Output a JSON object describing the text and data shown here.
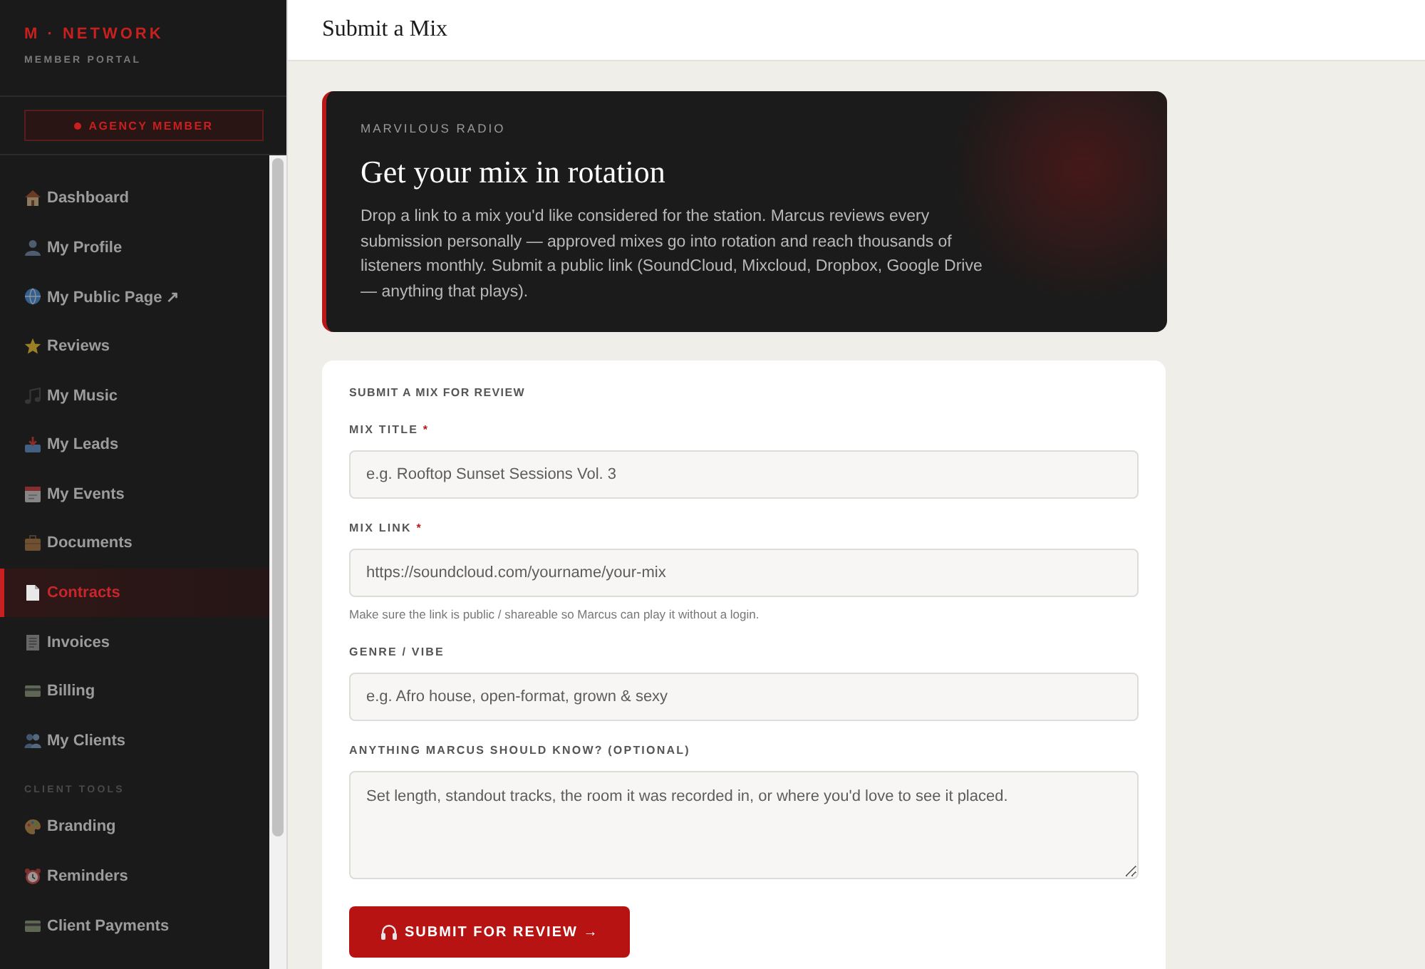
{
  "sidebar": {
    "brand": {
      "title": "M · NETWORK",
      "subtitle": "MEMBER PORTAL"
    },
    "badge": {
      "label": "AGENCY MEMBER"
    },
    "nav_groups": [
      {
        "items": [
          {
            "label": "Dashboard",
            "selected": false
          },
          {
            "label": "My Profile",
            "selected": false
          },
          {
            "label": "My Public Page ↗",
            "selected": false
          },
          {
            "label": "Reviews",
            "selected": false
          },
          {
            "label": "My Music",
            "selected": false
          },
          {
            "label": "My Leads",
            "selected": false
          },
          {
            "label": "My Events",
            "selected": false
          },
          {
            "label": "Documents",
            "selected": false
          },
          {
            "label": "Contracts",
            "selected": true
          },
          {
            "label": "Invoices",
            "selected": false
          },
          {
            "label": "Billing",
            "selected": false
          },
          {
            "label": "My Clients",
            "selected": false
          }
        ]
      },
      {
        "heading": "CLIENT TOOLS",
        "items": [
          {
            "label": "Branding",
            "selected": false
          },
          {
            "label": "Reminders",
            "selected": false
          },
          {
            "label": "Client Payments",
            "selected": false
          }
        ]
      }
    ]
  },
  "header": {
    "title": "Submit a Mix"
  },
  "hero": {
    "kicker": "MARVILOUS RADIO",
    "title": "Get your mix in rotation",
    "text": "Drop a link to a mix you'd like considered for the station. Marcus reviews every submission personally — approved mixes go into rotation and reach thousands of listeners monthly. Submit a public link (SoundCloud, Mixcloud, Dropbox, Google Drive — anything that plays)."
  },
  "form": {
    "title": "SUBMIT A MIX FOR REVIEW",
    "fields": [
      {
        "kind": "input",
        "label": "MIX TITLE",
        "required_mark": "*",
        "placeholder": "e.g. Rooftop Sunset Sessions Vol. 3"
      },
      {
        "kind": "input",
        "label": "MIX LINK",
        "required_mark": "*",
        "placeholder": "https://soundcloud.com/yourname/your-mix",
        "hint": "Make sure the link is public / shareable so Marcus can play it without a login."
      },
      {
        "kind": "input",
        "label": "GENRE / VIBE",
        "placeholder": "e.g. Afro house, open-format, grown & sexy"
      },
      {
        "kind": "textarea",
        "label": "ANYTHING MARCUS SHOULD KNOW? (OPTIONAL)",
        "placeholder": "Set length, standout tracks, the room it was recorded in, or where you'd love to see it placed."
      }
    ],
    "submit": {
      "label": "SUBMIT FOR REVIEW →"
    }
  }
}
